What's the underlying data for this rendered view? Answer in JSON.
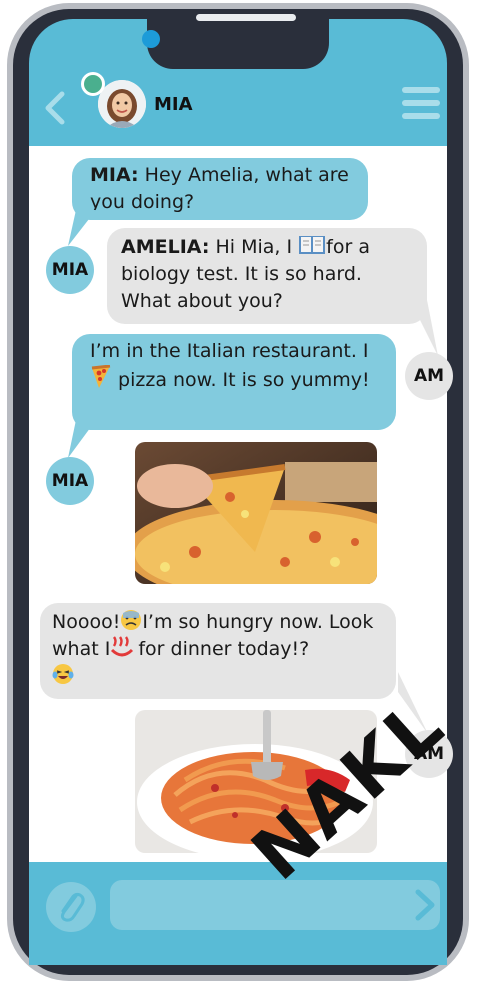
{
  "header": {
    "contact_name": "MIA"
  },
  "messages": [
    {
      "sender": "MIA",
      "name_label": "MIA:",
      "text": " Hey Amelia, what are you doing?"
    },
    {
      "sender": "AMELIA",
      "name_label": "AMELIA:",
      "text_a": " Hi Mia, I ",
      "text_b": " for a biology test. It is so hard. What about you?",
      "emoji": "book-icon"
    },
    {
      "sender": "MIA",
      "text_a": "I’m in the Italian restaurant. I",
      "text_b": " pizza now. It is so yummy!",
      "emoji": "pizza-icon"
    },
    {
      "sender": "MIA",
      "image": "pizza-photo"
    },
    {
      "sender": "AM",
      "text_a": "Noooo!",
      "text_b": "I’m so hungry now. Look what I",
      "text_c": " for dinner today!?",
      "emojis": [
        "sad-face-icon",
        "hot-springs-icon",
        "laughing-crying-icon"
      ]
    },
    {
      "sender": "AM",
      "image": "spaghetti-photo"
    }
  ],
  "avatars": {
    "mia": "MIA",
    "am": "AM"
  },
  "watermark": "NAKL",
  "colors": {
    "frame": "#2a2f3b",
    "accent": "#59bbd6",
    "bubble_blue": "#82cbde",
    "bubble_gray": "#e5e5e5",
    "status_dot": "#4aaf8e"
  }
}
